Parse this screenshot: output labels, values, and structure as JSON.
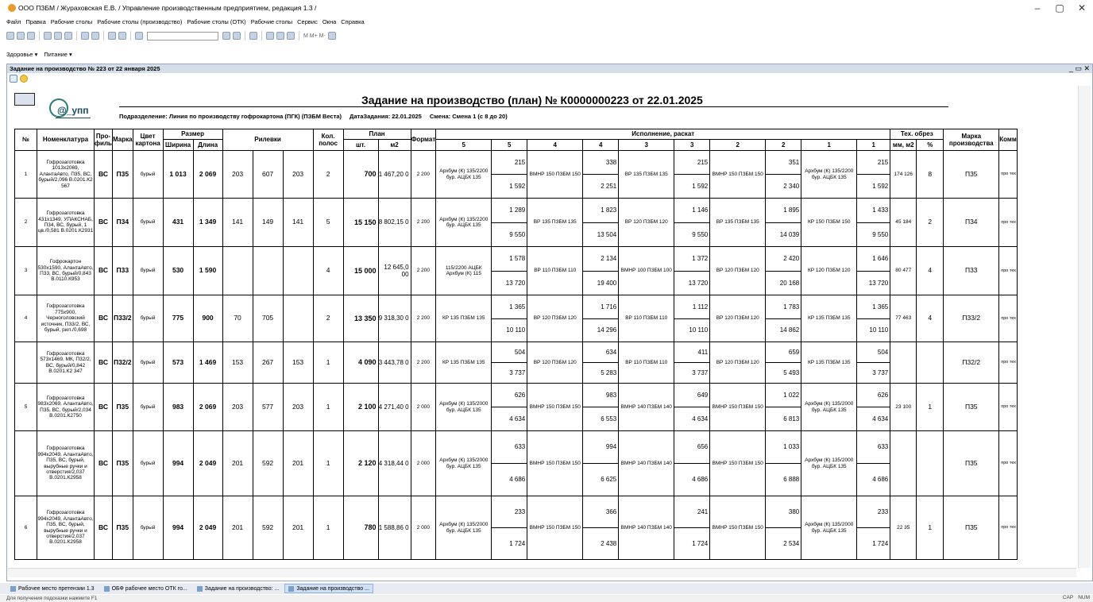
{
  "window": {
    "title": "ООО ПЗБМ / Жураховская Е.В. / Управление производственным предприятием, редакция 1.3 /"
  },
  "menu": [
    "Файл",
    "Правка",
    "Рабочие столы",
    "Рабочие столы (производство)",
    "Рабочие столы (ОТК)",
    "Рабочие столы",
    "Сервис",
    "Окна",
    "Справка"
  ],
  "toolbar": {
    "counters": "M  M+  M-"
  },
  "quickbar": [
    "Здоровье ▾",
    "Питание ▾"
  ],
  "doc_window": {
    "caption": "Задание на производство № 223 от 22 января 2025"
  },
  "sheet": {
    "title": "Задание на производство (план) № К0000000223 от 22.01.2025",
    "logo": "@_упп",
    "division": "Подразделение: Линия по производству гофрокартона (ПГК) (ПЗБМ Веста)",
    "date": "ДатаЗадания: 22.01.2025",
    "shift": "Смена: Смена 1 (с 8 до 20)",
    "headers": {
      "no": "№",
      "nom": "Номенклатура",
      "prof": "Про-филь",
      "mark": "Марка",
      "color": "Цвет картона",
      "size": "Размер",
      "width": "Ширина",
      "length": "Длина",
      "rilev": "Рилевки",
      "kol": "Кол. полос",
      "plan": "План",
      "sht": "шт.",
      "m2": "м2",
      "format": "Формат",
      "isp": "Исполнение, раскат",
      "c5": "5",
      "c4": "4",
      "c3": "3",
      "c2": "2",
      "c1": "1",
      "obrez": "Тех. обрез",
      "mm": "мм, м2",
      "pct": "%",
      "markpr": "Марка производства",
      "comm": "Комм"
    },
    "rows": [
      {
        "no": "1",
        "nom": "Гофрозаготовка 1013x2069, АлантаАвто, П35, ВС, бурый/2,096 В.0201.К2 567",
        "prof": "ВС",
        "mark": "П35",
        "color": "бурый",
        "w": "1 013",
        "l": "2 069",
        "r1": "203",
        "r2": "607",
        "r3": "203",
        "kol": "2",
        "sht": "700",
        "m2": "1 467,20 0",
        "fmt": "2 200",
        "s5": "Архбум (К) 135/2200 бур. АЦБК 135",
        "v5a": "215",
        "v5b": "1 592",
        "s4": "ВМНР 150 ПЗБМ 150",
        "v4a": "338",
        "v4b": "2 251",
        "s3": "ВР 135 ПЗБМ 135",
        "v3a": "215",
        "v3b": "1 592",
        "s2": "ВМНР 150 ПЗБМ 150",
        "v2a": "351",
        "v2b": "2 340",
        "s1": "Архбум (К) 135/2200 бур. АЦБК 135",
        "v1a": "215",
        "v1b": "1 592",
        "mm": "174 126",
        "pct": "8",
        "mp": "П35",
        "cm": "про тех"
      },
      {
        "no": "2",
        "nom": "Гофрозаготовка 431x1349, УПАКСНАБ, П34, ВС, бурый, 1 цв./0,581 В.0201.К2931",
        "prof": "ВС",
        "mark": "П34",
        "color": "бурый",
        "w": "431",
        "l": "1 349",
        "r1": "141",
        "r2": "149",
        "r3": "141",
        "kol": "5",
        "sht": "15 150",
        "m2": "8 802,15 0",
        "fmt": "2 200",
        "s5": "Архбум (К) 135/2200 бур. АЦБК 135",
        "v5a": "1 289",
        "v5b": "9 550",
        "s4": "ВР 135 ПЗБМ 135",
        "v4a": "1 823",
        "v4b": "13 504",
        "s3": "ВР 120 ПЗБМ 120",
        "v3a": "1 146",
        "v3b": "9 550",
        "s2": "ВР 135 ПЗБМ 135",
        "v2a": "1 895",
        "v2b": "14 039",
        "s1": "КР 150 ПЗБМ 150",
        "v1a": "1 433",
        "v1b": "9 550",
        "mm": "45 184",
        "pct": "2",
        "mp": "П34",
        "cm": "про тех"
      },
      {
        "no": "3",
        "nom": "Гофрокартон 530x1590, АлантаАвто, П33, ВС, бурый/0,843 В.0110.К953",
        "prof": "ВС",
        "mark": "П33",
        "color": "бурый",
        "w": "530",
        "l": "1 590",
        "r1": "",
        "r2": "",
        "r3": "",
        "kol": "4",
        "sht": "15 000",
        "m2": "12 645,0 00",
        "fmt": "2 200",
        "s5": "115/2200 АЦБК Архбум (К) 115",
        "v5a": "1 578",
        "v5b": "13 720",
        "s4": "ВР 110 ПЗБМ 110",
        "v4a": "2 134",
        "v4b": "19 400",
        "s3": "ВМНР 100 ПЗБМ 100",
        "v3a": "1 372",
        "v3b": "13 720",
        "s2": "ВР 120 ПЗБМ 120",
        "v2a": "2 420",
        "v2b": "20 168",
        "s1": "КР 120 ПЗБМ 120",
        "v1a": "1 646",
        "v1b": "13 720",
        "mm": "80 477",
        "pct": "4",
        "mp": "П33",
        "cm": "про тех"
      },
      {
        "no": "4",
        "nom": "Гофрозаготовка 775x900, Черноголовский источник, П33/2, ВС, бурый, рил./0,698",
        "prof": "ВС",
        "mark": "П33/2",
        "color": "бурый",
        "w": "775",
        "l": "900",
        "r1": "70",
        "r2": "705",
        "r3": "",
        "kol": "2",
        "sht": "13 350",
        "m2": "9 318,30 0",
        "fmt": "2 200",
        "s5": "КР 135 ПЗБМ 135",
        "v5a": "1 365",
        "v5b": "10 110",
        "s4": "ВР 120 ПЗБМ 120",
        "v4a": "1 716",
        "v4b": "14 296",
        "s3": "ВР 110 ПЗБМ 110",
        "v3a": "1 112",
        "v3b": "10 110",
        "s2": "ВР 120 ПЗБМ 120",
        "v2a": "1 783",
        "v2b": "14 862",
        "s1": "КР 135 ПЗБМ 135",
        "v1a": "1 365",
        "v1b": "10 110",
        "mm": "77 463",
        "pct": "4",
        "mp": "П33/2",
        "cm": "про тех"
      },
      {
        "no": "",
        "nom": "Гофрозаготовка 573x1469, МК, П32/2, ВС, бурый/0,842 В.0201.К2 347",
        "prof": "ВС",
        "mark": "П32/2",
        "color": "бурый",
        "w": "573",
        "l": "1 469",
        "r1": "153",
        "r2": "267",
        "r3": "153",
        "kol": "1",
        "sht": "4 090",
        "m2": "3 443,78 0",
        "fmt": "2 200",
        "s5": "КР 135 ПЗБМ 135",
        "v5a": "504",
        "v5b": "3 737",
        "s4": "ВР 120 ПЗБМ 120",
        "v4a": "634",
        "v4b": "5 283",
        "s3": "ВР 110 ПЗБМ 110",
        "v3a": "411",
        "v3b": "3 737",
        "s2": "ВР 120 ПЗБМ 120",
        "v2a": "659",
        "v2b": "5 493",
        "s1": "КР 135 ПЗБМ 135",
        "v1a": "504",
        "v1b": "3 737",
        "mm": "",
        "pct": "",
        "mp": "П32/2",
        "cm": "про тех"
      },
      {
        "no": "5",
        "nom": "Гофрозаготовка 983x2069, АлантаАвто, П35, ВС, бурый/2,034 В.0201.К2750",
        "prof": "ВС",
        "mark": "П35",
        "color": "бурый",
        "w": "983",
        "l": "2 069",
        "r1": "203",
        "r2": "577",
        "r3": "203",
        "kol": "1",
        "sht": "2 100",
        "m2": "4 271,40 0",
        "fmt": "2 000",
        "s5": "Архбум (К) 135/2000 бур. АЦБК 135",
        "v5a": "626",
        "v5b": "4 634",
        "s4": "ВМНР 150 ПЗБМ 150",
        "v4a": "983",
        "v4b": "6 553",
        "s3": "ВМНР 140 ПЗБМ 140",
        "v3a": "649",
        "v3b": "4 634",
        "s2": "ВМНР 150 ПЗБМ 150",
        "v2a": "1 022",
        "v2b": "6 813",
        "s1": "Архбум (К) 135/2000 бур. АЦБК 135",
        "v1a": "626",
        "v1b": "4 634",
        "mm": "23 100",
        "pct": "1",
        "mp": "П35",
        "cm": "про тех"
      },
      {
        "no": "",
        "nom": "Гофрозаготовка 994x2049, АлантаАвто, П35, ВС, бурый, вырубные ручки и отверстия/2,037 В.0201.К2958",
        "prof": "ВС",
        "mark": "П35",
        "color": "бурый",
        "w": "994",
        "l": "2 049",
        "r1": "201",
        "r2": "592",
        "r3": "201",
        "kol": "1",
        "sht": "2 120",
        "m2": "4 318,44 0",
        "fmt": "2 000",
        "s5": "Архбум (К) 135/2000 бур. АЦБК 135",
        "v5a": "633",
        "v5b": "4 686",
        "s4": "ВМНР 150 ПЗБМ 150",
        "v4a": "994",
        "v4b": "6 625",
        "s3": "ВМНР 140 ПЗБМ 140",
        "v3a": "656",
        "v3b": "4 686",
        "s2": "ВМНР 150 ПЗБМ 150",
        "v2a": "1 033",
        "v2b": "6 888",
        "s1": "Архбум (К) 135/2000 бур. АЦБК 135",
        "v1a": "633",
        "v1b": "4 686",
        "mm": "",
        "pct": "",
        "mp": "П35",
        "cm": "про тех"
      },
      {
        "no": "6",
        "nom": "Гофрозаготовка 994x2049, АлантаАвто, П35, ВС, бурый, вырубные ручки и отверстия/2,037 В.0201.К2958",
        "prof": "ВС",
        "mark": "П35",
        "color": "бурый",
        "w": "994",
        "l": "2 049",
        "r1": "201",
        "r2": "592",
        "r3": "201",
        "kol": "1",
        "sht": "780",
        "m2": "1 588,86 0",
        "fmt": "2 000",
        "s5": "Архбум (К) 135/2000 бур. АЦБК 135",
        "v5a": "233",
        "v5b": "1 724",
        "s4": "ВМНР 150 ПЗБМ 150",
        "v4a": "366",
        "v4b": "2 438",
        "s3": "ВМНР 140 ПЗБМ 140",
        "v3a": "241",
        "v3b": "1 724",
        "s2": "ВМНР 150 ПЗБМ 150",
        "v2a": "380",
        "v2b": "2 534",
        "s1": "Архбум (К) 135/2000 бур. АЦБК 135",
        "v1a": "233",
        "v1b": "1 724",
        "mm": "22 35",
        "pct": "1",
        "mp": "П35",
        "cm": "про тех"
      }
    ]
  },
  "taskbar": [
    {
      "label": "Рабочее место претензии 1.3",
      "active": false
    },
    {
      "label": "ОБФ рабочее место ОТК го...",
      "active": false
    },
    {
      "label": "Задание на производство: ...",
      "active": false
    },
    {
      "label": "Задание на производство ...",
      "active": true
    }
  ],
  "status": {
    "hint": "Для получения подсказки нажмите F1",
    "caps": "CAP",
    "num": "NUM"
  }
}
